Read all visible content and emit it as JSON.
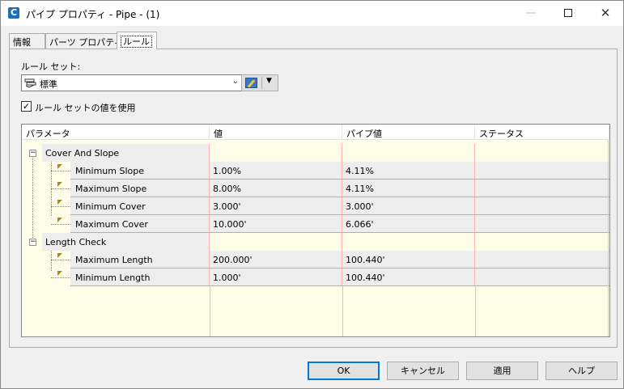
{
  "window": {
    "app_icon_letter": "C",
    "title": "パイプ プロパティ - Pipe - (1)",
    "minimize_icon": "minimize-icon",
    "maximize_icon": "maximize-icon",
    "close_icon": "close-icon"
  },
  "tabs": [
    {
      "label": "情報",
      "active": false
    },
    {
      "label": "パーツ プロパティ",
      "active": false
    },
    {
      "label": "ルール",
      "active": true
    }
  ],
  "ruleset": {
    "label": "ルール セット:",
    "selected": "標準",
    "checkbox_label": "ルール セットの値を使用",
    "checkbox_checked": true
  },
  "grid": {
    "columns": [
      "パラメータ",
      "値",
      "パイプ値",
      "ステータス"
    ],
    "categories": [
      {
        "name": "Cover And Slope",
        "rows": [
          {
            "param": "Minimum Slope",
            "value": "1.00%",
            "pipe_value": "4.11%",
            "status": ""
          },
          {
            "param": "Maximum Slope",
            "value": "8.00%",
            "pipe_value": "4.11%",
            "status": ""
          },
          {
            "param": "Minimum Cover",
            "value": "3.000'",
            "pipe_value": "3.000'",
            "status": ""
          },
          {
            "param": "Maximum Cover",
            "value": "10.000'",
            "pipe_value": "6.066'",
            "status": ""
          }
        ]
      },
      {
        "name": "Length Check",
        "rows": [
          {
            "param": "Maximum Length",
            "value": "200.000'",
            "pipe_value": "100.440'",
            "status": ""
          },
          {
            "param": "Minimum Length",
            "value": "1.000'",
            "pipe_value": "100.440'",
            "status": ""
          }
        ]
      }
    ]
  },
  "buttons": {
    "ok": "OK",
    "cancel": "キャンセル",
    "apply": "適用",
    "help": "ヘルプ"
  },
  "colors": {
    "grid_background": "#fefde8",
    "row_background": "#ededed",
    "default_button_border": "#0078d7"
  }
}
